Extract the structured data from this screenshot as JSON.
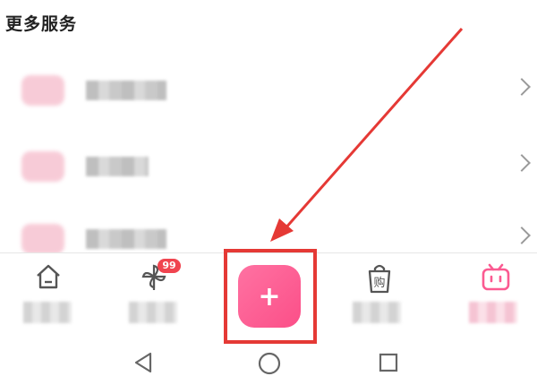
{
  "section": {
    "title": "更多服务"
  },
  "services": [
    {
      "label": "████████",
      "icon": "wifi-icon"
    },
    {
      "label": "██████",
      "icon": "truck-icon"
    },
    {
      "label": "████████",
      "icon": "gift-icon"
    }
  ],
  "tabbar": {
    "home": {
      "label": "███",
      "icon": "home-icon"
    },
    "dynamic": {
      "label": "███",
      "icon": "pinwheel-icon",
      "badge": "99"
    },
    "publish": {
      "glyph": "+",
      "icon": "plus-icon"
    },
    "mall": {
      "label": "███",
      "icon": "shopping-bag-icon",
      "bag_text": "购"
    },
    "mine": {
      "label": "███",
      "icon": "tv-icon"
    }
  },
  "colors": {
    "accent": "#fb5a91",
    "annotation": "#e53935",
    "badge": "#f0444f"
  }
}
